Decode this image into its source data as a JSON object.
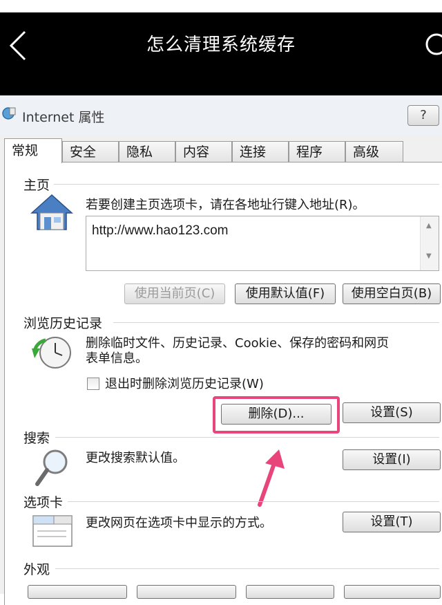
{
  "mobile_header": {
    "title": "怎么清理系统缓存"
  },
  "dialog": {
    "title": "Internet 属性",
    "help_label": "?",
    "tabs": [
      {
        "label": "常规",
        "active": true
      },
      {
        "label": "安全"
      },
      {
        "label": "隐私"
      },
      {
        "label": "内容"
      },
      {
        "label": "连接"
      },
      {
        "label": "程序"
      },
      {
        "label": "高级"
      }
    ],
    "home": {
      "section_label": "主页",
      "description": "若要创建主页选项卡，请在各地址行键入地址(R)。",
      "url_value": "http://www.hao123.com",
      "buttons": {
        "use_current": "使用当前页(C)",
        "use_default": "使用默认值(F)",
        "use_blank": "使用空白页(B)"
      }
    },
    "history": {
      "section_label": "浏览历史记录",
      "description_line1": "删除临时文件、历史记录、Cookie、保存的密码和网页",
      "description_line2": "表单信息。",
      "checkbox_label": "退出时删除浏览历史记录(W)",
      "checkbox_checked": false,
      "delete_button": "删除(D)...",
      "settings_button": "设置(S)"
    },
    "search": {
      "section_label": "搜索",
      "description": "更改搜索默认值。",
      "settings_button": "设置(I)"
    },
    "tabs_section": {
      "section_label": "选项卡",
      "description": "更改网页在选项卡中显示的方式。",
      "settings_button": "设置(T)"
    },
    "appearance": {
      "section_label": "外观"
    }
  },
  "colors": {
    "highlight": "#e8457a",
    "header_bg": "#000000"
  }
}
